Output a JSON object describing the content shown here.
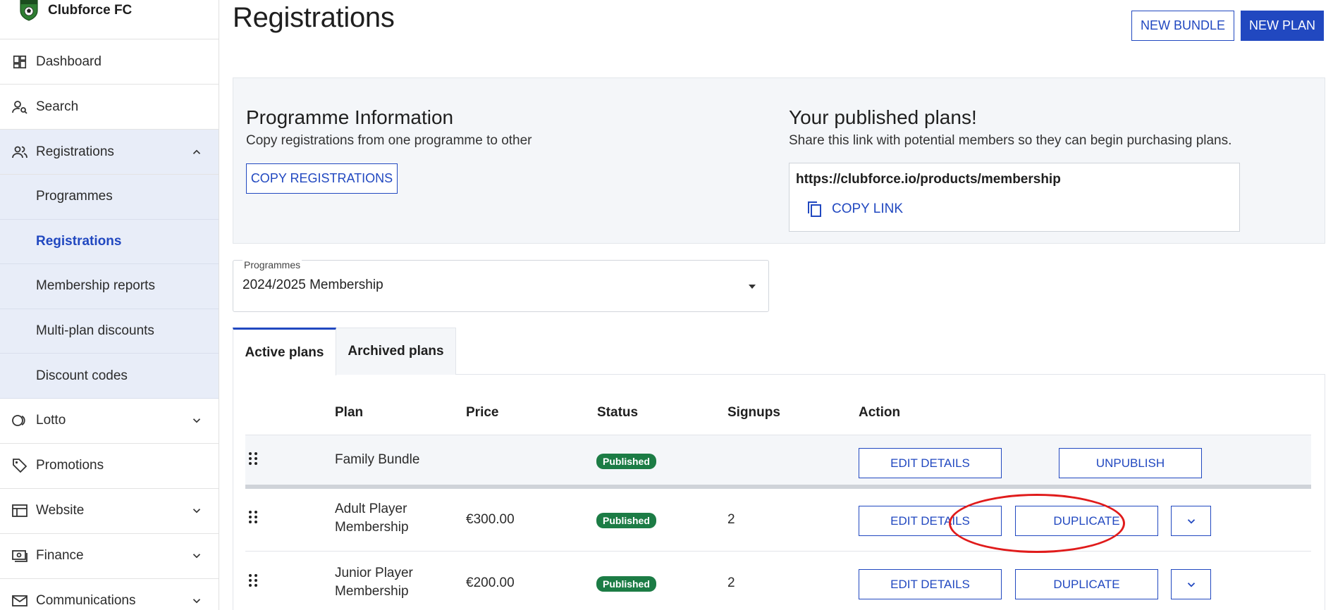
{
  "brand": {
    "name": "Clubforce FC"
  },
  "sidebar": {
    "items": [
      {
        "label": "Dashboard",
        "icon": "dashboard-icon"
      },
      {
        "label": "Search",
        "icon": "person-search-icon"
      },
      {
        "label": "Registrations",
        "icon": "people-icon",
        "expanded": true
      },
      {
        "label": "Lotto",
        "icon": "lotto-icon"
      },
      {
        "label": "Promotions",
        "icon": "tag-icon"
      },
      {
        "label": "Website",
        "icon": "website-icon"
      },
      {
        "label": "Finance",
        "icon": "money-icon"
      },
      {
        "label": "Communications",
        "icon": "mail-icon"
      }
    ],
    "sub_items": [
      {
        "label": "Programmes"
      },
      {
        "label": "Registrations",
        "active": true
      },
      {
        "label": "Membership reports"
      },
      {
        "label": "Multi-plan discounts"
      },
      {
        "label": "Discount codes"
      }
    ]
  },
  "header": {
    "title": "Registrations",
    "new_bundle_label": "NEW BUNDLE",
    "new_plan_label": "NEW PLAN"
  },
  "programme_info": {
    "title": "Programme Information",
    "description": "Copy registrations from one programme to other",
    "copy_button_label": "COPY REGISTRATIONS"
  },
  "published": {
    "title": "Your published plans!",
    "description": "Share this link with potential members so they can begin purchasing plans.",
    "url": "https://clubforce.io/products/membership",
    "copy_link_label": "COPY LINK"
  },
  "programmes_select": {
    "label": "Programmes",
    "value": "2024/2025 Membership"
  },
  "tabs": [
    {
      "label": "Active plans",
      "active": true
    },
    {
      "label": "Archived plans"
    }
  ],
  "table": {
    "headers": {
      "plan": "Plan",
      "price": "Price",
      "status": "Status",
      "signups": "Signups",
      "action": "Action"
    },
    "rows": [
      {
        "plan": "Family Bundle",
        "price": "",
        "status": "Published",
        "signups": "",
        "edit_label": "EDIT DETAILS",
        "second_label": "UNPUBLISH"
      },
      {
        "plan_line1": "Adult Player",
        "plan_line2": "Membership",
        "price": "€300.00",
        "status": "Published",
        "signups": "2",
        "edit_label": "EDIT DETAILS",
        "second_label": "DUPLICATE"
      },
      {
        "plan_line1": "Junior Player",
        "plan_line2": "Membership",
        "price": "€200.00",
        "status": "Published",
        "signups": "2",
        "edit_label": "EDIT DETAILS",
        "second_label": "DUPLICATE"
      }
    ]
  },
  "colors": {
    "accent": "#2148c0",
    "status_published": "#1c7c45",
    "annotation": "#e01b1b",
    "panel_bg": "#f4f6f9",
    "sidebar_open_bg": "#e8edf8"
  }
}
